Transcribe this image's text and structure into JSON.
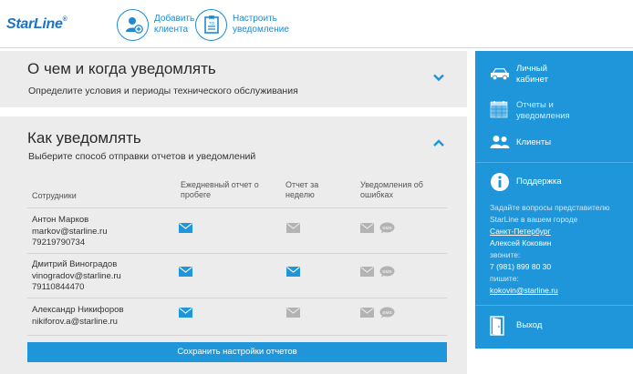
{
  "header": {
    "logo": "StarLine",
    "logo_mark": "®",
    "add_client_label": "Добавить клиента",
    "setup_notify_label": "Настроить уведомление"
  },
  "panel_what": {
    "title": "О чем и когда уведомлять",
    "subtitle": "Определите условия и периоды технического обслуживания"
  },
  "panel_how": {
    "title": "Как уведомлять",
    "subtitle": "Выберите способ отправки отчетов и уведомлений",
    "columns": {
      "employees": "Сотрудники",
      "daily": "Ежедневный отчет о пробеге",
      "weekly": "Отчет за неделю",
      "errors": "Уведомления об ошибках"
    },
    "employees": [
      {
        "name": "Антон Марков",
        "email": "markov@starline.ru",
        "phone": "79219790734",
        "daily": true,
        "weekly": false,
        "err_mail": false,
        "err_sms": false
      },
      {
        "name": "Дмитрий Виноградов",
        "email": "vinogradov@starline.ru",
        "phone": "79110844470",
        "daily": true,
        "weekly": true,
        "err_mail": false,
        "err_sms": false
      },
      {
        "name": "Александр Никифоров",
        "email": "nikiforov.a@starline.ru",
        "phone": "",
        "daily": true,
        "weekly": false,
        "err_mail": false,
        "err_sms": false
      }
    ],
    "sms_badge": "SMS",
    "save_label": "Сохранить настройки отчетов"
  },
  "sidebar": {
    "cabinet": "Личный кабинет",
    "reports": "Отчеты и уведомления",
    "clients": "Клиенты",
    "support": "Поддержка",
    "support_text": "Задайте вопросы представителю StarLine в вашем городе",
    "city": "Санкт-Петербург",
    "rep_name": "Алексей Коковин",
    "call_label": "звоните:",
    "phone": "7 (981) 899 80 30",
    "write_label": "пишите:",
    "email": "kokovin@starline.ru",
    "logout": "Выход"
  },
  "colors": {
    "accent": "#1f96d9",
    "icon_active": "#1f96d9",
    "icon_inactive": "#b3b3b3"
  }
}
